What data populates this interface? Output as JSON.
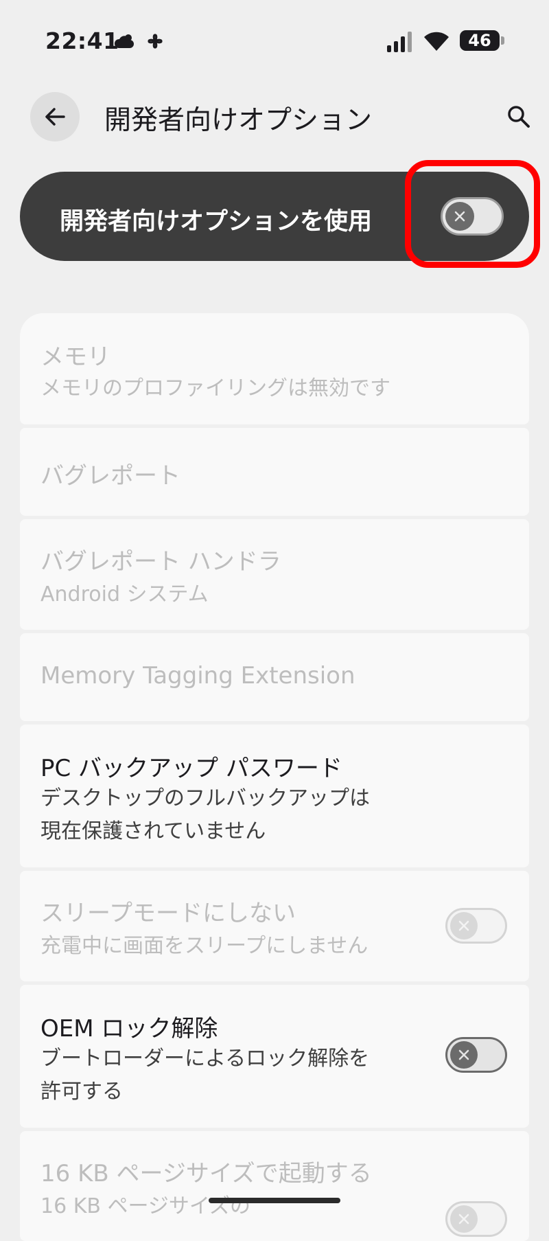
{
  "status_bar": {
    "time": "22:41",
    "icons": [
      "cloud-icon",
      "pinwheel-icon",
      "signal-icon",
      "wifi-icon"
    ],
    "battery": "46"
  },
  "app_bar": {
    "title": "開発者向けオプション",
    "back_icon": "arrow-left-icon",
    "search_icon": "search-icon"
  },
  "master_switch": {
    "label": "開発者向けオプションを使用",
    "state": "off",
    "highlight_color": "#ff0000"
  },
  "settings": [
    {
      "title": "メモリ",
      "subtitle": "メモリのプロファイリングは無効です",
      "enabled": false
    },
    {
      "title": "バグレポート",
      "enabled": false
    },
    {
      "title": "バグレポート ハンドラ",
      "subtitle": "Android システム",
      "enabled": false
    },
    {
      "title": "Memory Tagging Extension",
      "enabled": false
    },
    {
      "title": "PC バックアップ パスワード",
      "subtitle_lines": [
        "デスクトップのフルバックアップは",
        "現在保護されていません"
      ],
      "enabled": true
    },
    {
      "title": "スリープモードにしない",
      "subtitle": "充電中に画面をスリープにしません",
      "enabled": false,
      "toggle": "off"
    },
    {
      "title": "OEM ロック解除",
      "subtitle_lines": [
        "ブートローダーによるロック解除を",
        "許可する"
      ],
      "enabled": true,
      "toggle": "off"
    },
    {
      "title": "16 KB ページサイズで起動する",
      "subtitle": "16 KB ページサイズの",
      "enabled": false,
      "toggle": "off"
    }
  ],
  "colors": {
    "background": "#efefef",
    "card": "#f9f9f9",
    "master_bg": "#3d3d3d",
    "disabled_text": "#bdbdbd"
  }
}
